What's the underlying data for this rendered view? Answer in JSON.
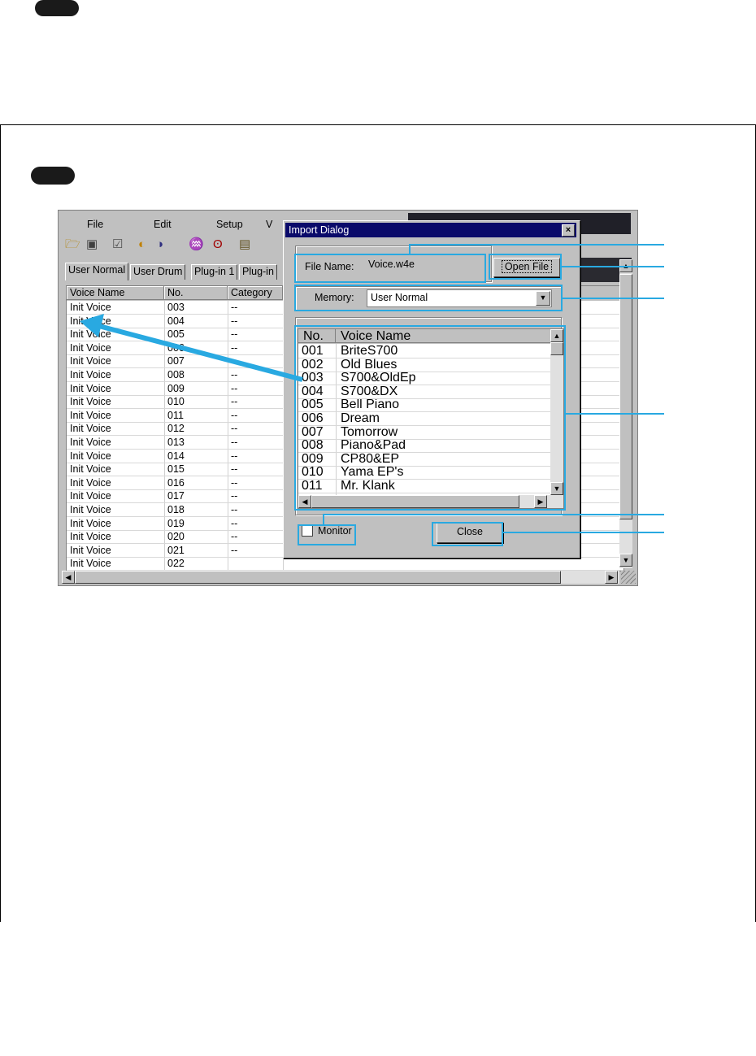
{
  "menu": {
    "file": "File",
    "edit": "Edit",
    "setup": "Setup",
    "view_partial": "V"
  },
  "toolbar_icons": [
    "open-folder-icon",
    "save-disk-icon",
    "properties-icon",
    "import-icon",
    "export-icon",
    "voice-edit-icon",
    "ear-icon",
    "clipboard-icon"
  ],
  "tabs": [
    "User Normal",
    "User Drum",
    "Plug-in 1",
    "Plug-in"
  ],
  "grid": {
    "columns": [
      "Voice Name",
      "No.",
      "Category"
    ],
    "rows": [
      [
        "Init Voice",
        "003",
        "--"
      ],
      [
        "Init Voice",
        "004",
        "--"
      ],
      [
        "Init Voice",
        "005",
        "--"
      ],
      [
        "Init Voice",
        "006",
        "--"
      ],
      [
        "Init Voice",
        "007",
        "--"
      ],
      [
        "Init Voice",
        "008",
        "--"
      ],
      [
        "Init Voice",
        "009",
        "--"
      ],
      [
        "Init Voice",
        "010",
        "--"
      ],
      [
        "Init Voice",
        "011",
        "--"
      ],
      [
        "Init Voice",
        "012",
        "--"
      ],
      [
        "Init Voice",
        "013",
        "--"
      ],
      [
        "Init Voice",
        "014",
        "--"
      ],
      [
        "Init Voice",
        "015",
        "--"
      ],
      [
        "Init Voice",
        "016",
        "--"
      ],
      [
        "Init Voice",
        "017",
        "--"
      ],
      [
        "Init Voice",
        "018",
        "--"
      ],
      [
        "Init Voice",
        "019",
        "--"
      ],
      [
        "Init Voice",
        "020",
        "--"
      ],
      [
        "Init Voice",
        "021",
        "--"
      ],
      [
        "Init Voice",
        "022",
        ""
      ]
    ]
  },
  "dialog": {
    "title": "Import Dialog",
    "file_name_label": "File Name:",
    "file_name_value": "Voice.w4e",
    "open_file_label": "Open File",
    "memory_label": "Memory:",
    "memory_value": "User Normal",
    "list_columns": [
      "No.",
      "Voice Name"
    ],
    "list_rows": [
      [
        "001",
        "BriteS700"
      ],
      [
        "002",
        "Old Blues"
      ],
      [
        "003",
        "S700&OldEp"
      ],
      [
        "004",
        "S700&DX"
      ],
      [
        "005",
        "Bell Piano"
      ],
      [
        "006",
        "Dream"
      ],
      [
        "007",
        "Tomorrow"
      ],
      [
        "008",
        "Piano&Pad"
      ],
      [
        "009",
        "CP80&EP"
      ],
      [
        "010",
        "Yama EP's"
      ],
      [
        "011",
        "Mr. Klank"
      ]
    ],
    "monitor_label": "Monitor",
    "close_label": "Close"
  },
  "colors": {
    "highlight": "#29a9e1",
    "titlebar": "#0a0a6a",
    "face": "#c0c0c0"
  }
}
